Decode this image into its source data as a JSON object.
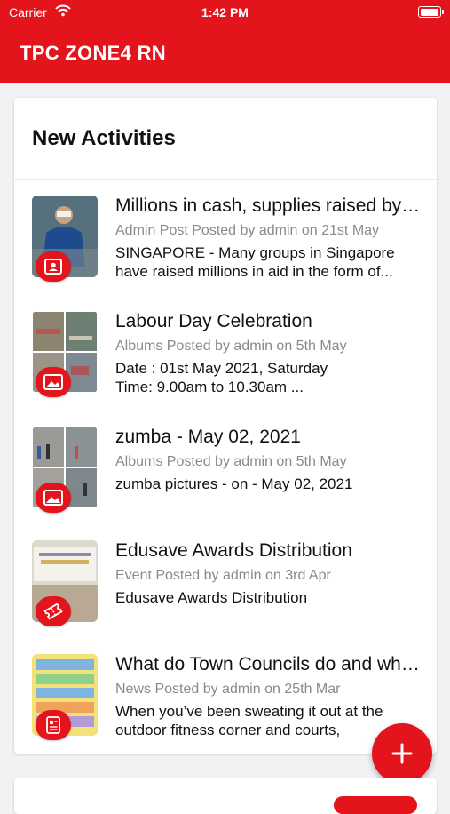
{
  "status_bar": {
    "carrier": "Carrier",
    "time": "1:42 PM"
  },
  "app_bar": {
    "title": "TPC ZONE4 RN"
  },
  "activities": {
    "heading": "New Activities",
    "items": [
      {
        "title": "Millions in cash, supplies raised by Singapore groups",
        "meta": "Admin Post Posted by admin on 21st May",
        "desc_lines": [
          "SINGAPORE - Many groups in Singapore",
          "have raised millions in aid in the form of..."
        ],
        "badge_icon": "person-card-icon"
      },
      {
        "title": "Labour Day Celebration",
        "meta": "Albums Posted by admin on 5th May",
        "desc_lines": [
          "Date : 01st May 2021, Saturday",
          "Time: 9.00am to 10.30am ..."
        ],
        "badge_icon": "image-icon"
      },
      {
        "title": "zumba - May 02, 2021",
        "meta": "Albums Posted by admin on 5th May",
        "desc_lines": [
          "zumba pictures - on - May 02, 2021"
        ],
        "badge_icon": "image-icon"
      },
      {
        "title": "Edusave Awards Distribution",
        "meta": "Event Posted by admin on 3rd Apr",
        "desc_lines": [
          "Edusave Awards Distribution"
        ],
        "badge_icon": "ticket-icon"
      },
      {
        "title": "What do Town Councils do and what...",
        "meta": "News Posted by admin on 25th Mar",
        "desc_lines": [
          "When you’ve been sweating it out at the",
          "outdoor fitness corner and courts,"
        ],
        "badge_icon": "news-icon"
      }
    ]
  },
  "fab": {
    "icon": "plus-icon"
  },
  "colors": {
    "accent": "#e3141b",
    "background": "#f2f2f4"
  }
}
